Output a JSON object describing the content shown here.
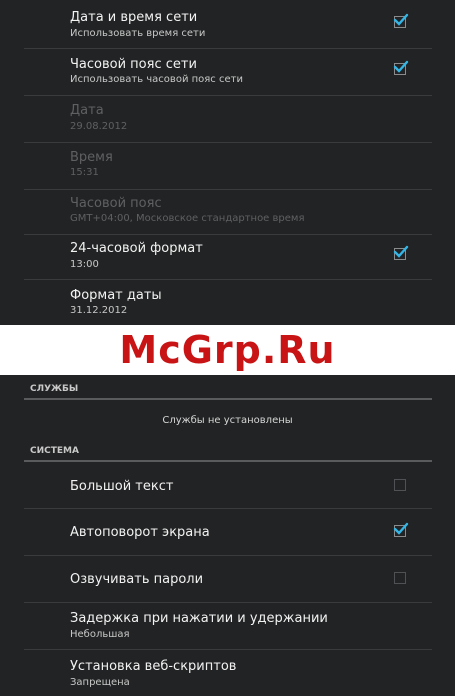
{
  "top": {
    "items": [
      {
        "title": "Дата и время сети",
        "subtitle": "Использовать время сети",
        "checkbox": true,
        "checked": true,
        "enabled": true
      },
      {
        "title": "Часовой пояс сети",
        "subtitle": "Использовать часовой пояс сети",
        "checkbox": true,
        "checked": true,
        "enabled": true
      },
      {
        "title": "Дата",
        "subtitle": "29.08.2012",
        "checkbox": false,
        "enabled": false
      },
      {
        "title": "Время",
        "subtitle": "15:31",
        "checkbox": false,
        "enabled": false
      },
      {
        "title": "Часовой пояс",
        "subtitle": "GMT+04:00, Московское стандартное время",
        "checkbox": false,
        "enabled": false
      },
      {
        "title": "24-часовой формат",
        "subtitle": "13:00",
        "checkbox": true,
        "checked": true,
        "enabled": true
      },
      {
        "title": "Формат даты",
        "subtitle": "31.12.2012",
        "checkbox": false,
        "enabled": true
      }
    ]
  },
  "watermark": "McGrp.Ru",
  "services": {
    "header": "СЛУЖБЫ",
    "empty_text": "Службы не установлены"
  },
  "system": {
    "header": "СИСТЕМА",
    "items": [
      {
        "title": "Большой текст",
        "checkbox": true,
        "checked": false
      },
      {
        "title": "Автоповорот экрана",
        "checkbox": true,
        "checked": true
      },
      {
        "title": "Озвучивать пароли",
        "checkbox": true,
        "checked": false
      },
      {
        "title": "Задержка при нажатии и удержании",
        "subtitle": "Небольшая",
        "checkbox": false
      },
      {
        "title": "Установка веб-скриптов",
        "subtitle": "Запрещена",
        "checkbox": false
      }
    ]
  },
  "colors": {
    "background": "#222324",
    "checkmark": "#33b5e5",
    "watermark": "#c81414"
  }
}
